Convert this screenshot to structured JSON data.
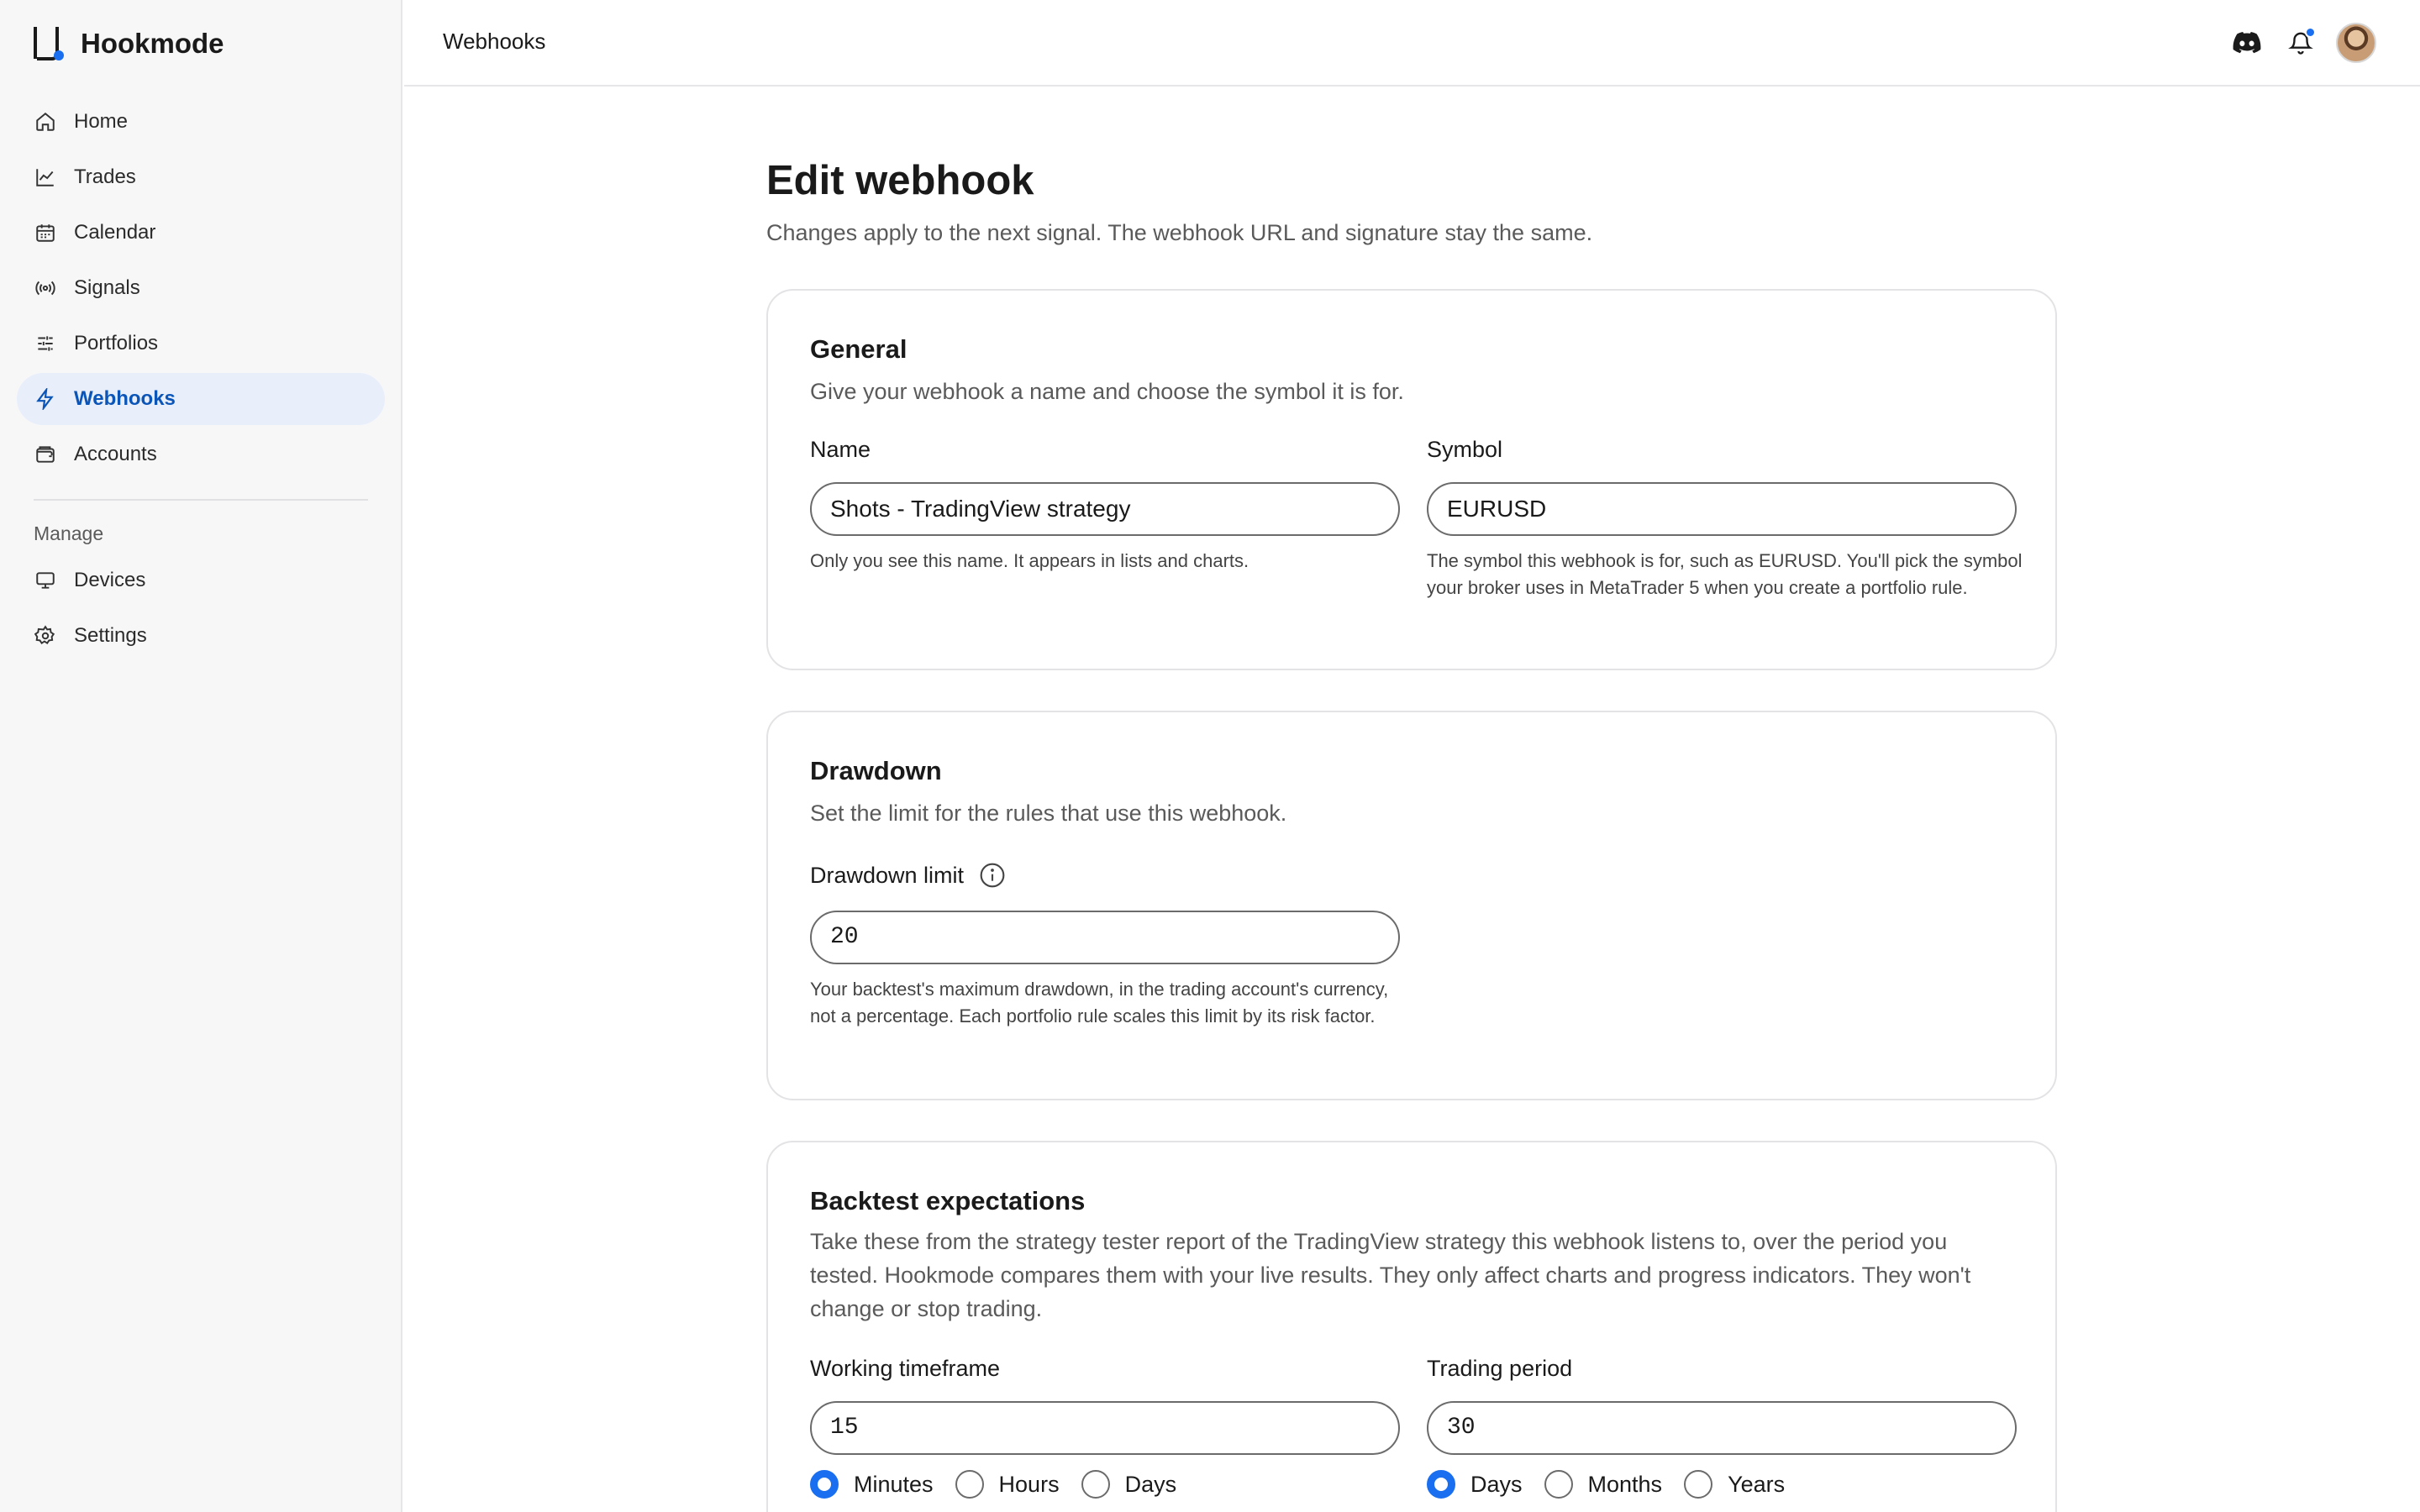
{
  "brand": {
    "name": "Hookmode"
  },
  "sidebar": {
    "items": [
      {
        "label": "Home",
        "icon": "home-icon"
      },
      {
        "label": "Trades",
        "icon": "chart-line-icon"
      },
      {
        "label": "Calendar",
        "icon": "calendar-icon"
      },
      {
        "label": "Signals",
        "icon": "broadcast-icon"
      },
      {
        "label": "Portfolios",
        "icon": "sliders-icon"
      },
      {
        "label": "Webhooks",
        "icon": "bolt-icon",
        "active": true
      },
      {
        "label": "Accounts",
        "icon": "wallet-icon"
      }
    ],
    "section_label": "Manage",
    "manage_items": [
      {
        "label": "Devices",
        "icon": "monitor-icon"
      },
      {
        "label": "Settings",
        "icon": "gear-icon"
      }
    ]
  },
  "topbar": {
    "breadcrumb": "Webhooks",
    "icons": [
      "discord-icon",
      "bell-icon",
      "avatar"
    ]
  },
  "page": {
    "title": "Edit webhook",
    "subtitle": "Changes apply to the next signal. The webhook URL and signature stay the same."
  },
  "general": {
    "title": "General",
    "description": "Give your webhook a name and choose the symbol it is for.",
    "name_label": "Name",
    "name_value": "Shots - TradingView strategy",
    "name_help": "Only you see this name. It appears in lists and charts.",
    "symbol_label": "Symbol",
    "symbol_value": "EURUSD",
    "symbol_help": "The symbol this webhook is for, such as EURUSD. You'll pick the symbol your broker uses in MetaTrader 5 when you create a portfolio rule."
  },
  "drawdown": {
    "title": "Drawdown",
    "description": "Set the limit for the rules that use this webhook.",
    "limit_label": "Drawdown limit",
    "limit_value": "20",
    "limit_help": "Your backtest's maximum drawdown, in the trading account's currency, not a percentage. Each portfolio rule scales this limit by its risk factor."
  },
  "backtest": {
    "title": "Backtest expectations",
    "description": "Take these from the strategy tester report of the TradingView strategy this webhook listens to, over the period you tested. Hookmode compares them with your live results. They only affect charts and progress indicators. They won't change or stop trading.",
    "timeframe_label": "Working timeframe",
    "timeframe_value": "15",
    "timeframe_units": [
      "Minutes",
      "Hours",
      "Days"
    ],
    "timeframe_selected": "Minutes",
    "period_label": "Trading period",
    "period_value": "30",
    "period_units": [
      "Days",
      "Months",
      "Years"
    ],
    "period_selected": "Days"
  },
  "colors": {
    "accent": "#1a6ff0",
    "active_bg": "#e8effb",
    "active_text": "#0b55b8"
  }
}
